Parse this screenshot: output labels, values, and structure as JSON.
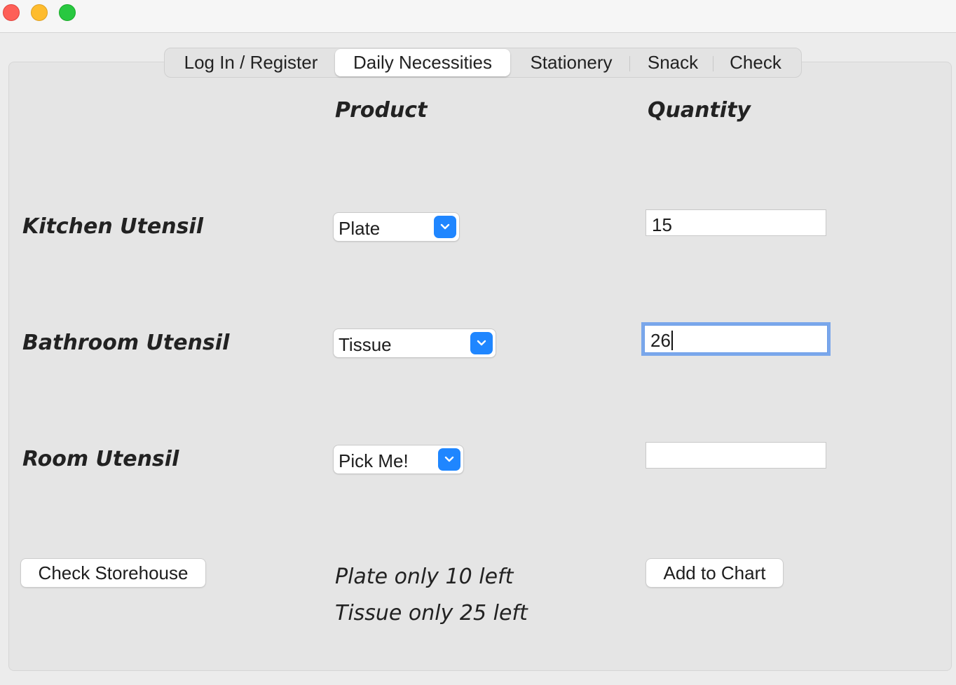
{
  "window": {
    "controls": [
      "close",
      "minimize",
      "zoom"
    ]
  },
  "tabs": [
    {
      "label": "Log In / Register"
    },
    {
      "label": "Daily Necessities",
      "active": true
    },
    {
      "label": "Stationery"
    },
    {
      "label": "Snack"
    },
    {
      "label": "Check"
    }
  ],
  "headers": {
    "product": "Product",
    "quantity": "Quantity"
  },
  "rows": [
    {
      "label": "Kitchen Utensil",
      "product": "Plate",
      "quantity": "15"
    },
    {
      "label": "Bathroom Utensil",
      "product": "Tissue",
      "quantity": "26"
    },
    {
      "label": "Room Utensil",
      "product": "Pick Me!",
      "quantity": ""
    }
  ],
  "buttons": {
    "check_storehouse": "Check Storehouse",
    "add_to_chart": "Add to Chart"
  },
  "messages": [
    "Plate only 10 left",
    "Tissue only 25 left"
  ],
  "colors": {
    "accent": "#1f86ff",
    "focus_ring": "#7aa7eb",
    "panel": "#e5e5e5"
  }
}
